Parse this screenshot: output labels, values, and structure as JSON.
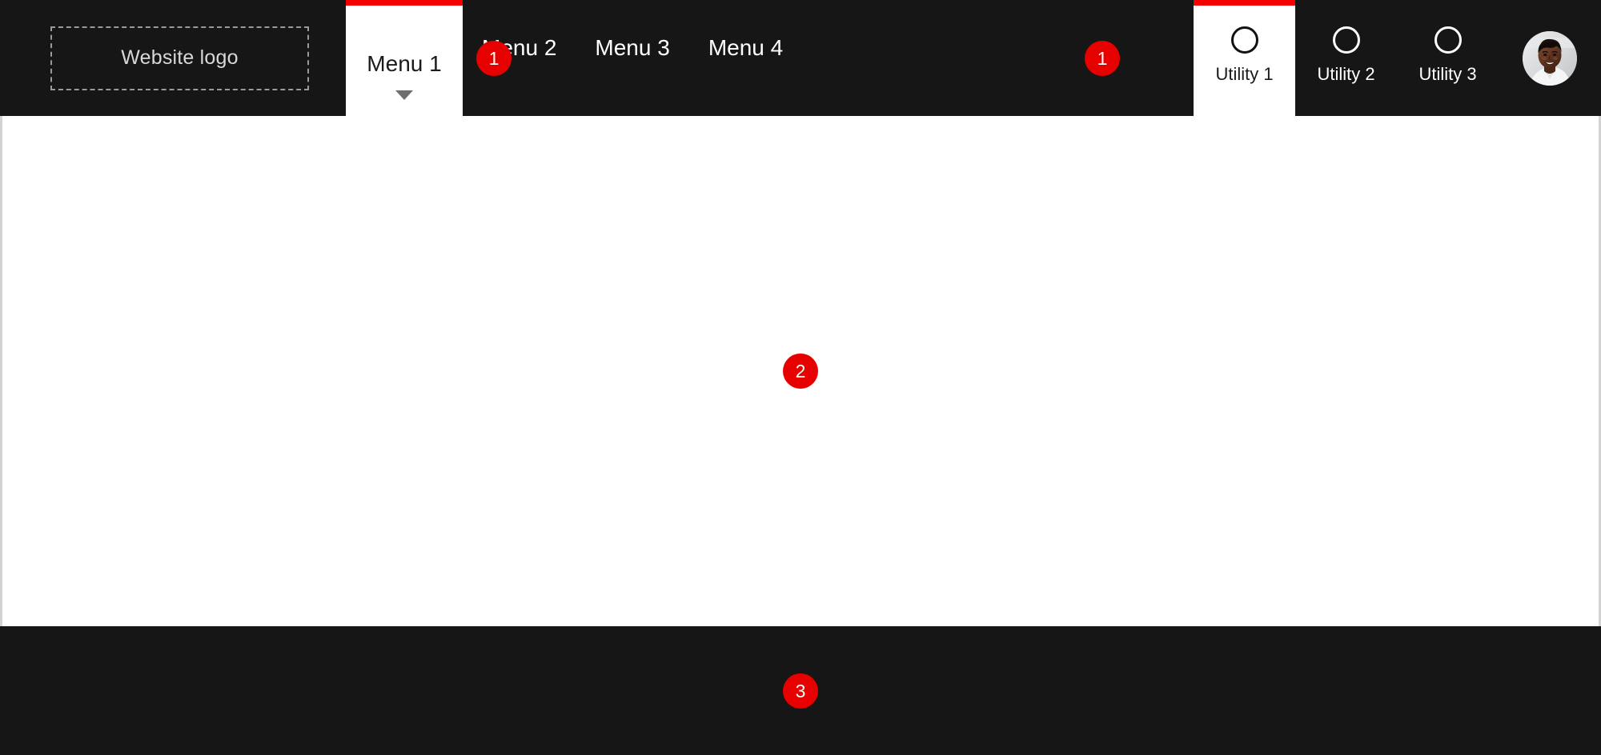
{
  "header": {
    "logo": {
      "label": "Website logo"
    },
    "main_menu": [
      {
        "label": "Menu 1",
        "active": true,
        "has_dropdown": true
      },
      {
        "label": "Menu 2",
        "active": false,
        "has_dropdown": false
      },
      {
        "label": "Menu 3",
        "active": false,
        "has_dropdown": false
      },
      {
        "label": "Menu 4",
        "active": false,
        "has_dropdown": false
      }
    ],
    "utility_menu": [
      {
        "label": "Utility 1",
        "icon": "circle-icon",
        "active": true
      },
      {
        "label": "Utility 2",
        "icon": "circle-icon",
        "active": false
      },
      {
        "label": "Utility 3",
        "icon": "circle-icon",
        "active": false
      }
    ],
    "avatar": {
      "icon": "user-avatar-photo"
    }
  },
  "annotations": [
    {
      "number": "1",
      "target": "main-navigation"
    },
    {
      "number": "1",
      "target": "utility-navigation"
    },
    {
      "number": "2",
      "target": "page-body"
    },
    {
      "number": "3",
      "target": "page-footer"
    }
  ],
  "colors": {
    "header_background": "#161616",
    "footer_background": "#161616",
    "body_background": "#ffffff",
    "accent_red": "#f50000",
    "badge_red": "#e60000",
    "active_tab_background": "#ffffff",
    "body_border": "#d3d3d3",
    "logo_border": "#9a9a9a",
    "caret": "#6e6e6e"
  }
}
